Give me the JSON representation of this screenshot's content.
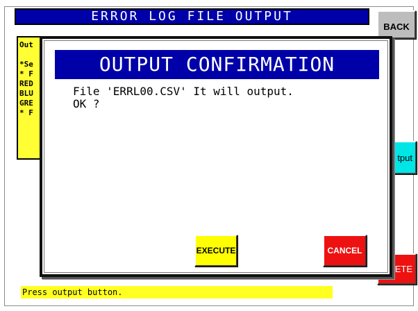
{
  "screen_title": "ERROR LOG FILE OUTPUT",
  "buttons": {
    "back": "BACK",
    "output_partial": "tput",
    "delete_partial": "LETE"
  },
  "info_panel": {
    "lines": [
      "Out",
      "",
      "*Se",
      "* F",
      "RED",
      "BLU",
      "GRE",
      "* F"
    ]
  },
  "status_message": "Press output button.",
  "dialog": {
    "title": "OUTPUT CONFIRMATION",
    "message_line1": "File 'ERRL00.CSV' It will output.",
    "message_line2": "OK ?",
    "execute_label": "EXECUTE",
    "cancel_label": "CANCEL"
  },
  "colors": {
    "title_bar": "#0000a8",
    "info_panel": "#ffff33",
    "execute": "#ffff00",
    "cancel": "#ee1111",
    "output": "#00e6e6",
    "back": "#bdbdbd"
  }
}
